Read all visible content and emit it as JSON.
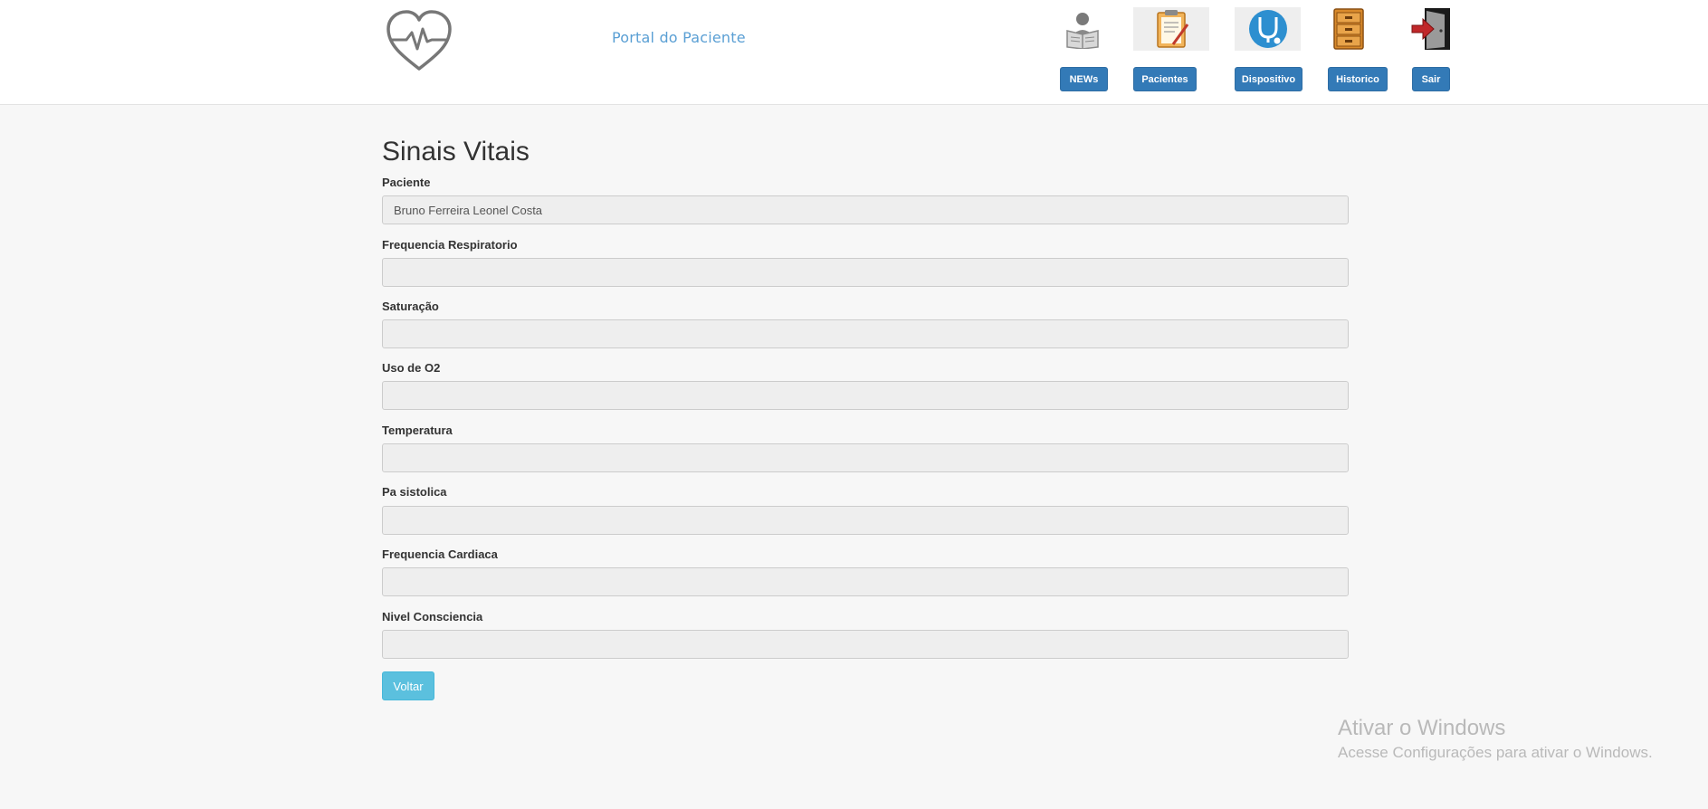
{
  "header": {
    "portal_title": "Portal do Paciente",
    "nav": [
      {
        "label": "NEWs",
        "icon": "newspaper-reader-icon"
      },
      {
        "label": "Pacientes",
        "icon": "clipboard-icon"
      },
      {
        "label": "Dispositivo",
        "icon": "stethoscope-icon"
      },
      {
        "label": "Historico",
        "icon": "file-cabinet-icon"
      },
      {
        "label": "Sair",
        "icon": "exit-door-icon"
      }
    ],
    "logo_icon": "heart-pulse-icon"
  },
  "main": {
    "title": "Sinais Vitais",
    "fields": [
      {
        "label": "Paciente",
        "value": "Bruno Ferreira Leonel Costa"
      },
      {
        "label": "Frequencia Respiratorio",
        "value": ""
      },
      {
        "label": "Saturação",
        "value": ""
      },
      {
        "label": "Uso de O2",
        "value": ""
      },
      {
        "label": "Temperatura",
        "value": ""
      },
      {
        "label": "Pa sistolica",
        "value": ""
      },
      {
        "label": "Frequencia Cardiaca",
        "value": ""
      },
      {
        "label": "Nivel Consciencia",
        "value": ""
      }
    ],
    "back_button": "Voltar"
  },
  "watermark": {
    "title": "Ativar o Windows",
    "subtitle": "Acesse Configurações para ativar o Windows."
  },
  "colors": {
    "primary": "#337ab7",
    "info": "#5bc0de",
    "portal_title": "#5a9fd4"
  }
}
